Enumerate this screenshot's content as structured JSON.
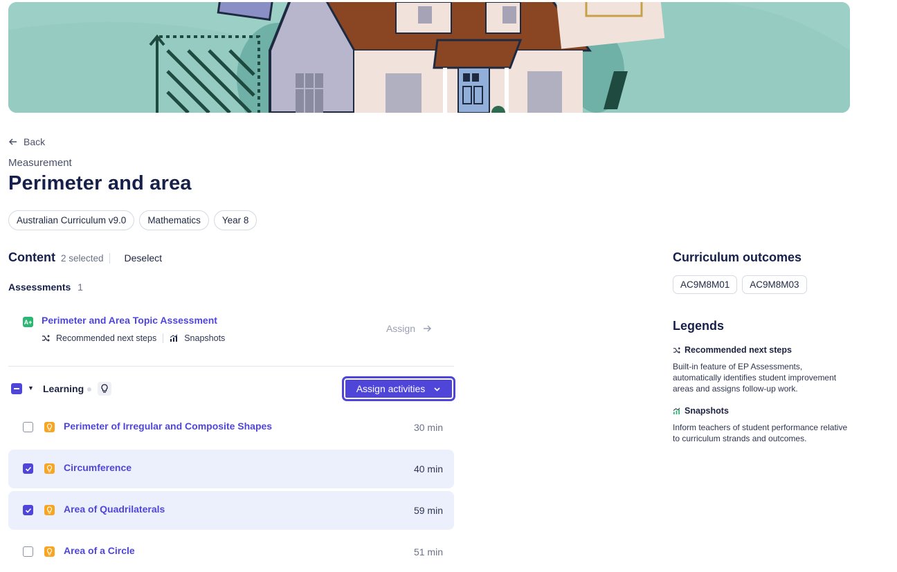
{
  "nav": {
    "back_label": "Back"
  },
  "header": {
    "eyebrow": "Measurement",
    "title": "Perimeter and area"
  },
  "tags": [
    "Australian Curriculum v9.0",
    "Mathematics",
    "Year 8"
  ],
  "content": {
    "title": "Content",
    "selected_text": "2 selected",
    "deselect_label": "Deselect",
    "assessments": {
      "label": "Assessments",
      "count": "1",
      "items": [
        {
          "icon_text": "A+",
          "title": "Perimeter and Area Topic Assessment",
          "feature_1": "Recommended next steps",
          "feature_2": "Snapshots",
          "assign_label": "Assign"
        }
      ]
    },
    "learning": {
      "label": "Learning",
      "assign_button": "Assign activities",
      "activities": [
        {
          "title": "Perimeter of Irregular and Composite Shapes",
          "duration": "30 min",
          "selected": false
        },
        {
          "title": "Circumference",
          "duration": "40 min",
          "selected": true
        },
        {
          "title": "Area of Quadrilaterals",
          "duration": "59 min",
          "selected": true
        },
        {
          "title": "Area of a Circle",
          "duration": "51 min",
          "selected": false
        }
      ]
    }
  },
  "sidebar": {
    "outcomes_title": "Curriculum outcomes",
    "outcomes": [
      "AC9M8M01",
      "AC9M8M03"
    ],
    "legends_title": "Legends",
    "legends": [
      {
        "icon": "shuffle-icon",
        "title": "Recommended next steps",
        "text": "Built-in feature of EP Assessments, automatically identifies student improvement areas and assigns follow-up work."
      },
      {
        "icon": "chart-icon",
        "title": "Snapshots",
        "text": "Inform teachers of student performance relative to curriculum strands and outcomes."
      }
    ]
  },
  "colors": {
    "accent": "#4f46d9",
    "selected_row": "#ecf0fc",
    "heading": "#16204a",
    "assessment_icon": "#2bb673",
    "activity_icon": "#f6a623"
  }
}
